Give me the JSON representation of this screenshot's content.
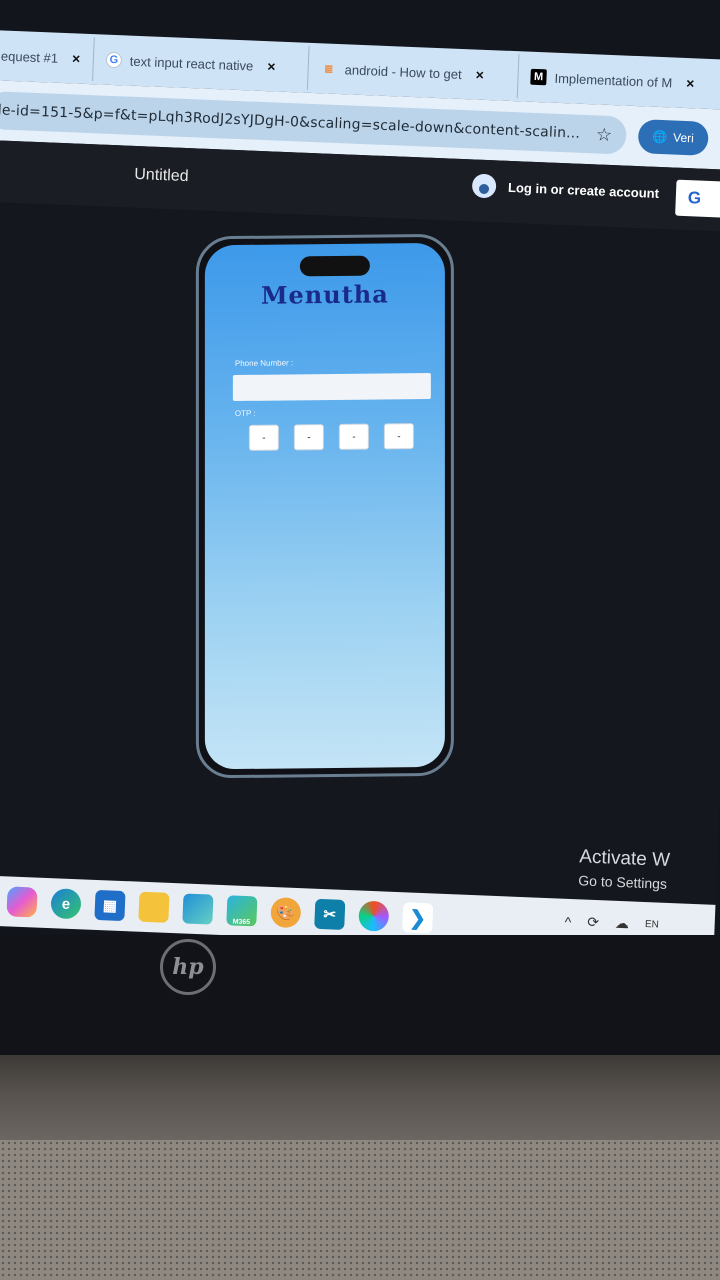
{
  "browser": {
    "tabs": [
      {
        "label": "equest #1",
        "icon": "pull-request-icon"
      },
      {
        "label": "text input react native",
        "icon": "google-icon"
      },
      {
        "label": "android - How to get",
        "icon": "stackoverflow-icon"
      },
      {
        "label": "Implementation of M",
        "icon": "medium-icon"
      }
    ],
    "tab_close": "×",
    "url": "de-id=151-5&p=f&t=pLqh3RodJ2sYJDgH-0&scaling=scale-down&content-scalin...",
    "extension_label": "Veri"
  },
  "app": {
    "doc_title": "Untitled",
    "login_label": "Log in or create account",
    "g_button": "G"
  },
  "phone": {
    "title": "Menutha",
    "phone_label": "Phone Number :",
    "otp_label": "OTP :",
    "otp_digits": [
      "-",
      "-",
      "-",
      "-"
    ]
  },
  "watermark": {
    "line1": "Activate W",
    "line2": "Go to Settings"
  },
  "taskbar": {
    "apps": [
      "chrome-icon",
      "copilot-icon",
      "edge-icon",
      "store-icon",
      "file-explorer-icon",
      "photos-icon",
      "m365-icon",
      "paint-icon",
      "snipping-icon",
      "figma-icon",
      "vscode-icon"
    ],
    "m365_label": "M365",
    "tray_lang": "EN"
  },
  "device": {
    "brand": "hp"
  },
  "colors": {
    "phone_gradient_top": "#3d99ea",
    "phone_gradient_bottom": "#c4e4f6",
    "app_title": "#1a2a8a"
  }
}
